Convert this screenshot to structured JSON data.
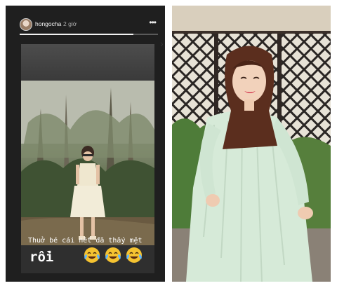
{
  "story": {
    "username": "hongocha",
    "timestamp": "2 giờ",
    "more_icon": "more-options-icon",
    "progress": 0.82,
    "caption_line1": "Thuở bé cái nết đã thấy mệt",
    "caption_line2": "rồi",
    "emojis": [
      "face-with-tears-of-joy",
      "face-with-tears-of-joy",
      "face-with-tears-of-joy"
    ],
    "next_icon": "chevron-right-icon"
  },
  "colors": {
    "story_bg": "#1f1f1f",
    "dress_mint": "#d6ead8",
    "lips": "#d54055"
  }
}
